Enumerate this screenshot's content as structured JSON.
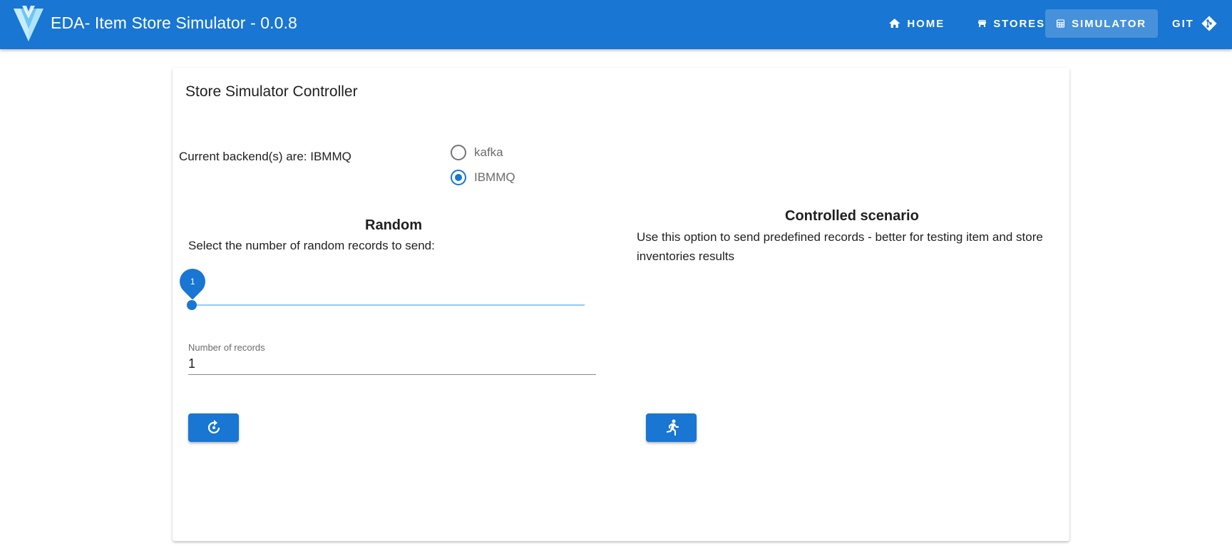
{
  "app": {
    "title": "EDA- Item Store Simulator - 0.0.8",
    "brand_color": "#1976d2"
  },
  "nav": {
    "home": {
      "label": "HOME",
      "icon": "home-icon"
    },
    "stores": {
      "label": "STORES",
      "icon": "store-icon"
    },
    "simulator": {
      "label": "SIMULATOR",
      "icon": "table-grid-icon",
      "active": true
    },
    "git": {
      "label": "GIT",
      "icon": "git-icon"
    }
  },
  "card": {
    "title": "Store Simulator Controller",
    "backend_text": "Current backend(s) are: IBMMQ",
    "backends": [
      {
        "label": "kafka",
        "checked": false
      },
      {
        "label": "IBMMQ",
        "checked": true
      }
    ]
  },
  "random": {
    "heading": "Random",
    "description": "Select the number of random records to send:",
    "slider_value": "1",
    "field_label": "Number of records",
    "field_value": "1",
    "button_icon": "restart-icon"
  },
  "controlled": {
    "heading": "Controlled scenario",
    "description": "Use this option to send predefined records - better for testing item and store inventories results",
    "button_icon": "run-icon"
  }
}
